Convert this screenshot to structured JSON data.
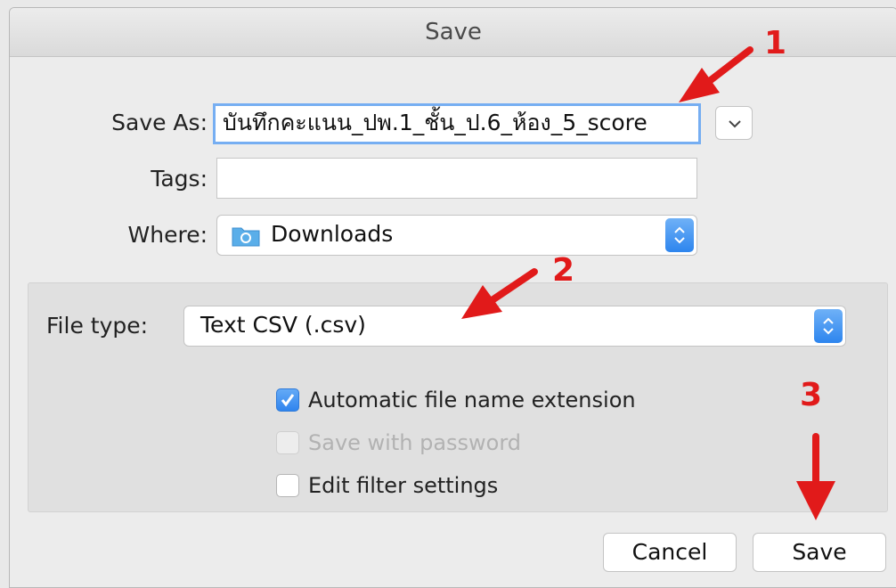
{
  "dialog": {
    "title": "Save",
    "save_as_label": "Save As:",
    "save_as_value": "บันทึกคะแนน_ปพ.1_ชั้น_ป.6_ห้อง_5_score",
    "tags_label": "Tags:",
    "tags_value": "",
    "where_label": "Where:",
    "where_value": "Downloads",
    "where_icon": "folder-icon",
    "expand_icon": "chevron-down-icon"
  },
  "options": {
    "file_type_label": "File type:",
    "file_type_value": "Text CSV (.csv)",
    "checkboxes": [
      {
        "label": "Automatic file name extension",
        "checked": true,
        "enabled": true
      },
      {
        "label": "Save with password",
        "checked": false,
        "enabled": false
      },
      {
        "label": "Edit filter settings",
        "checked": false,
        "enabled": true
      }
    ]
  },
  "buttons": {
    "cancel": "Cancel",
    "save": "Save"
  },
  "annotations": {
    "step1": "1",
    "step2": "2",
    "step3": "3",
    "color": "#e11a1a"
  },
  "colors": {
    "accent": "#2d85ee",
    "focus_ring": "#76aef2"
  }
}
